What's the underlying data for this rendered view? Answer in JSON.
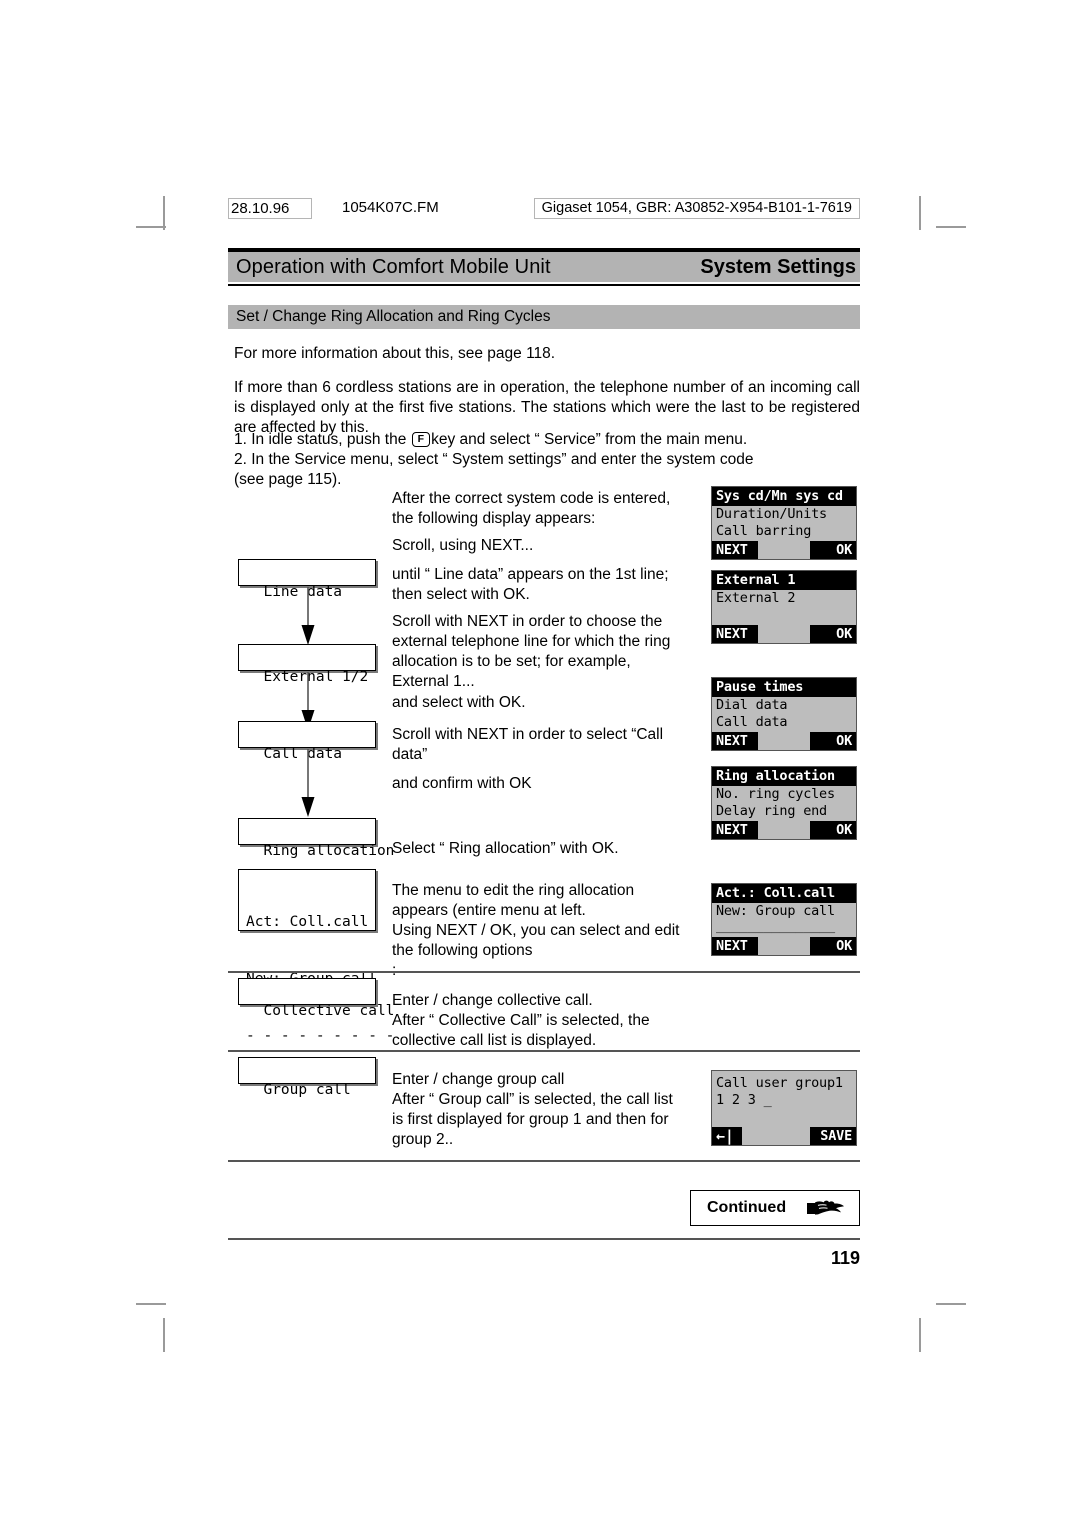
{
  "meta": {
    "date": "28.10.96",
    "filename": "1054K07C.FM",
    "part_info": "Gigaset 1054, GBR: A30852-X954-B101-1-7619"
  },
  "running_head": {
    "left": "Operation with Comfort Mobile Unit",
    "right": "System Settings"
  },
  "section": {
    "heading": "Set / Change Ring Allocation and Ring Cycles"
  },
  "intro": {
    "see_page": "For more information about this, see page 118.",
    "body": "If more than 6 cordless stations are in operation, the telephone number of an incoming call is displayed only at the first five stations. The stations which were the last to be registered are affected by this.",
    "step1_before": "1. In idle status, push the",
    "step1_key": "F",
    "step1_after": "key and select “ Service” from the main menu.",
    "step2": "2. In the Service menu, select “ System settings” and enter the system code",
    "step2_cont": "(see page 115)."
  },
  "flow_boxes": [
    {
      "label": "Line data"
    },
    {
      "label": "External 1/2"
    },
    {
      "label": "Call data"
    },
    {
      "label": "Ring allocation"
    },
    {
      "label_line1": "Act: Coll.call",
      "label_line2": "New: Group call",
      "label_line3": "- - - - - - - - -"
    },
    {
      "label": "Collective call"
    },
    {
      "label": "Group call"
    }
  ],
  "mid_text": {
    "t1": "After the correct system code is entered, the following display appears:",
    "t2": "Scroll, using NEXT...",
    "t3": "until “ Line data” appears on the 1st line; then select with OK.",
    "t4": "Scroll with NEXT in order to choose the external telephone line for which the ring allocation is to be set; for example, External 1...",
    "t5": "and select with OK.",
    "t6": "Scroll with NEXT in order to select “Call data”",
    "t7": "and confirm with OK",
    "t8": "Select “ Ring allocation” with OK.",
    "t9a": "The menu to edit the ring allocation appears (entire menu at left.",
    "t9b": "Using NEXT / OK, you can select and edit the following options",
    "t9c": ":",
    "t10a": "Enter / change collective call.",
    "t10b": "After “ Collective Call” is selected, the collective call list is displayed.",
    "t11a": "Enter / change group call",
    "t11b": "After “ Group call” is selected, the call list is first displayed for group 1 and then for group 2.."
  },
  "lcds": [
    {
      "title": "Sys cd/Mn sys cd",
      "line1": "Duration/Units",
      "line2": "Call barring",
      "soft_left": "NEXT",
      "soft_right": "OK"
    },
    {
      "title": "External 1",
      "line1": "External 2",
      "line2": "",
      "soft_left": "NEXT",
      "soft_right": "OK"
    },
    {
      "title": "Pause times",
      "line1": "Dial data",
      "line2": "Call data",
      "soft_left": "NEXT",
      "soft_right": "OK"
    },
    {
      "title": "Ring allocation",
      "line1": "No. ring cycles",
      "line2": "Delay ring end",
      "soft_left": "NEXT",
      "soft_right": "OK"
    },
    {
      "title": "Act.: Coll.call",
      "line1": "New: Group call",
      "line2": "_______________",
      "soft_left": "NEXT",
      "soft_right": "OK"
    }
  ],
  "lcd_save": {
    "line1": "Call user group1",
    "line2": "1 2 3 _",
    "soft_left_icon": "back-arrow-icon",
    "soft_right": "SAVE"
  },
  "footer": {
    "continued_label": "Continued",
    "hand_icon": "pointing-hand-icon",
    "page_number": "119"
  }
}
